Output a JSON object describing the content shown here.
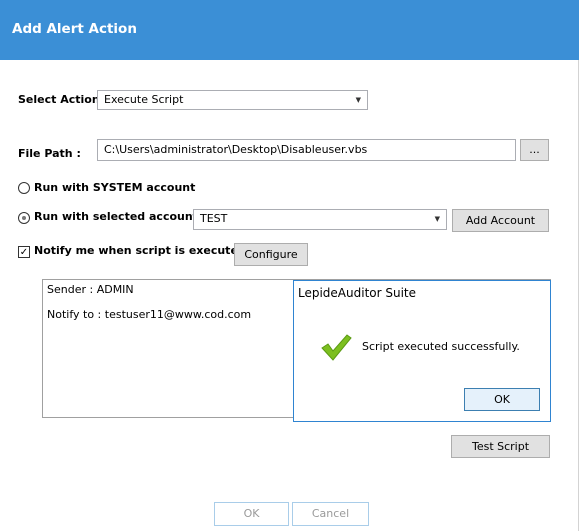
{
  "dialog": {
    "title": "Add Alert Action"
  },
  "select_action": {
    "label": "Select Action :",
    "value": "Execute Script"
  },
  "file_path": {
    "label": "File Path :",
    "value": "C:\\Users\\administrator\\Desktop\\Disableuser.vbs",
    "browse_label": "..."
  },
  "run_system": {
    "label": "Run with SYSTEM account",
    "selected": false
  },
  "run_selected": {
    "label": "Run with selected account",
    "selected": true,
    "account": "TEST",
    "add_account_label": "Add Account"
  },
  "notify": {
    "label": "Notify me when script is executed",
    "checked": true,
    "configure_label": "Configure"
  },
  "info_panel": {
    "sender": "Sender : ADMIN",
    "notify_to": "Notify to : testuser11@www.cod.com"
  },
  "message_box": {
    "title": "LepideAuditor Suite",
    "message": "Script executed successfully.",
    "ok_label": "OK",
    "icon": "checkmark-icon",
    "icon_color": "#7cbf1f"
  },
  "test_script_label": "Test Script",
  "footer": {
    "ok_label": "OK",
    "cancel_label": "Cancel"
  },
  "colors": {
    "titlebar": "#3b8fd6",
    "accent": "#2f84d1"
  }
}
